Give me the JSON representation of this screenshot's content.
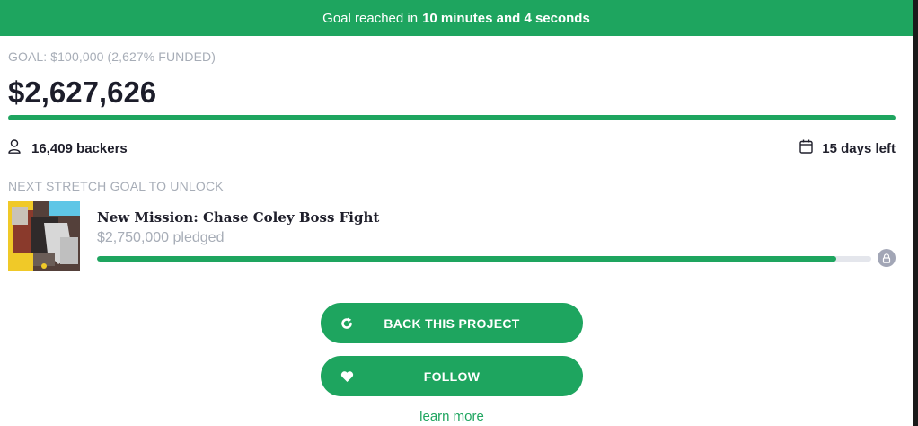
{
  "banner": {
    "prefix": "Goal reached in",
    "duration": "10 minutes and 4 seconds"
  },
  "funding": {
    "goal_text": "GOAL: $100,000 (2,627% FUNDED)",
    "amount": "$2,627,626",
    "progress_fraction": 1.0,
    "backers": "16,409 backers",
    "time_left": "15 days left"
  },
  "stretch_goal": {
    "section_label": "NEXT STRETCH GOAL TO UNLOCK",
    "title": "New Mission: Chase Coley Boss Fight",
    "pledged": "$2,750,000 pledged",
    "progress_fraction": 0.955
  },
  "actions": {
    "back_label": "BACK THIS PROJECT",
    "follow_label": "FOLLOW",
    "learn_more": "learn more"
  },
  "icons": {
    "backers": "user-icon",
    "days": "calendar-icon",
    "lock": "lock-icon",
    "back": "refresh-icon",
    "follow": "heart-icon"
  },
  "colors": {
    "accent": "#1ea55f",
    "muted": "#a7adb7",
    "text": "#1f1f2b"
  }
}
